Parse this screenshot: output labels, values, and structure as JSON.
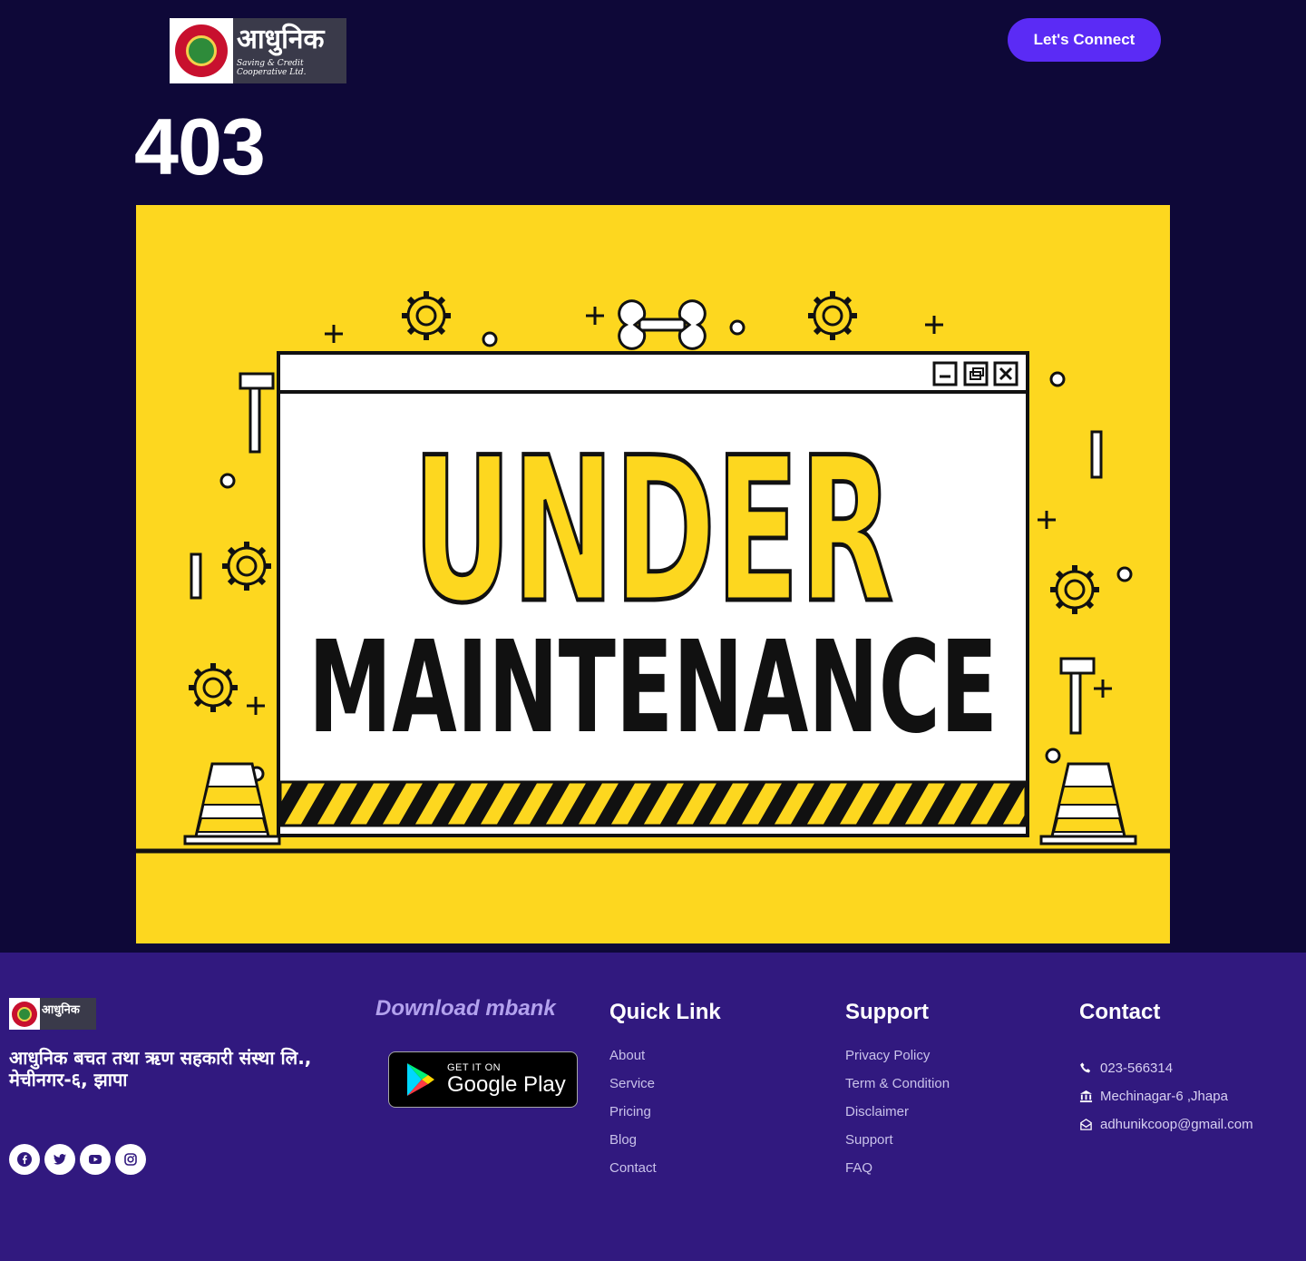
{
  "header": {
    "logo_text": "आधुनिक",
    "logo_subtext": "Saving & Credit Cooperative Ltd.",
    "cta_label": "Let's Connect"
  },
  "error": {
    "code": "403"
  },
  "banner": {
    "line1": "UNDER",
    "line2": "MAINTENANCE"
  },
  "footer": {
    "logo_text": "आधुनिक",
    "description": "आधुनिक बचत तथा ऋण सहकारी संस्था लि., मेचीनगर-६, झापा",
    "social": [
      "facebook-icon",
      "twitter-icon",
      "youtube-icon",
      "instagram-icon"
    ],
    "download_title": "Download mbank",
    "gplay_line1": "GET IT ON",
    "gplay_line2": "Google Play",
    "quick_link": {
      "title": "Quick Link",
      "items": [
        "About",
        "Service",
        "Pricing",
        "Blog",
        "Contact"
      ]
    },
    "support": {
      "title": "Support",
      "items": [
        "Privacy Policy",
        "Term & Condition",
        "Disclaimer",
        "Support",
        "FAQ"
      ]
    },
    "contact": {
      "title": "Contact",
      "phone": "023-566314",
      "address": "Mechinagar-6 ,Jhapa",
      "email": "adhunikcoop@gmail.com"
    }
  },
  "colors": {
    "page_bg": "#0e0838",
    "footer_bg": "#31197f",
    "accent": "#5b2bf5",
    "banner_yellow": "#fdd71f"
  }
}
